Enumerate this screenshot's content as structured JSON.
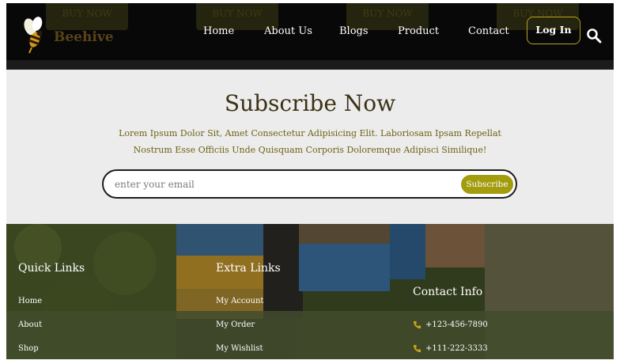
{
  "header": {
    "brand": "Beehive",
    "ghost_buttons": [
      "BUY NOW",
      "BUY NOW",
      "BUY NOW",
      "BUY NOW"
    ],
    "nav": [
      "Home",
      "About Us",
      "Blogs",
      "Product",
      "Contact"
    ],
    "login_label": "Log In",
    "search_icon": "search-icon",
    "accent_color": "#b5a21e"
  },
  "subscribe": {
    "title": "Subscribe Now",
    "description": "Lorem Ipsum Dolor Sit, Amet Consectetur Adipisicing Elit. Laboriosam Ipsam Repellat Nostrum Esse Officiis Unde Quisquam Corporis Doloremque Adipisci Similique!",
    "input_placeholder": "enter your email",
    "button_label": "Subscribe",
    "button_color": "#a39c0f"
  },
  "footer": {
    "quick_links": {
      "title": "Quick Links",
      "items": [
        "Home",
        "About",
        "Shop"
      ]
    },
    "extra_links": {
      "title": "Extra Links",
      "items": [
        "My Account",
        "My Order",
        "My Wishlist"
      ]
    },
    "contact": {
      "title": "Contact Info",
      "phones": [
        "+123-456-7890",
        "+111-222-3333"
      ],
      "phone_icon": "phone-icon"
    }
  }
}
